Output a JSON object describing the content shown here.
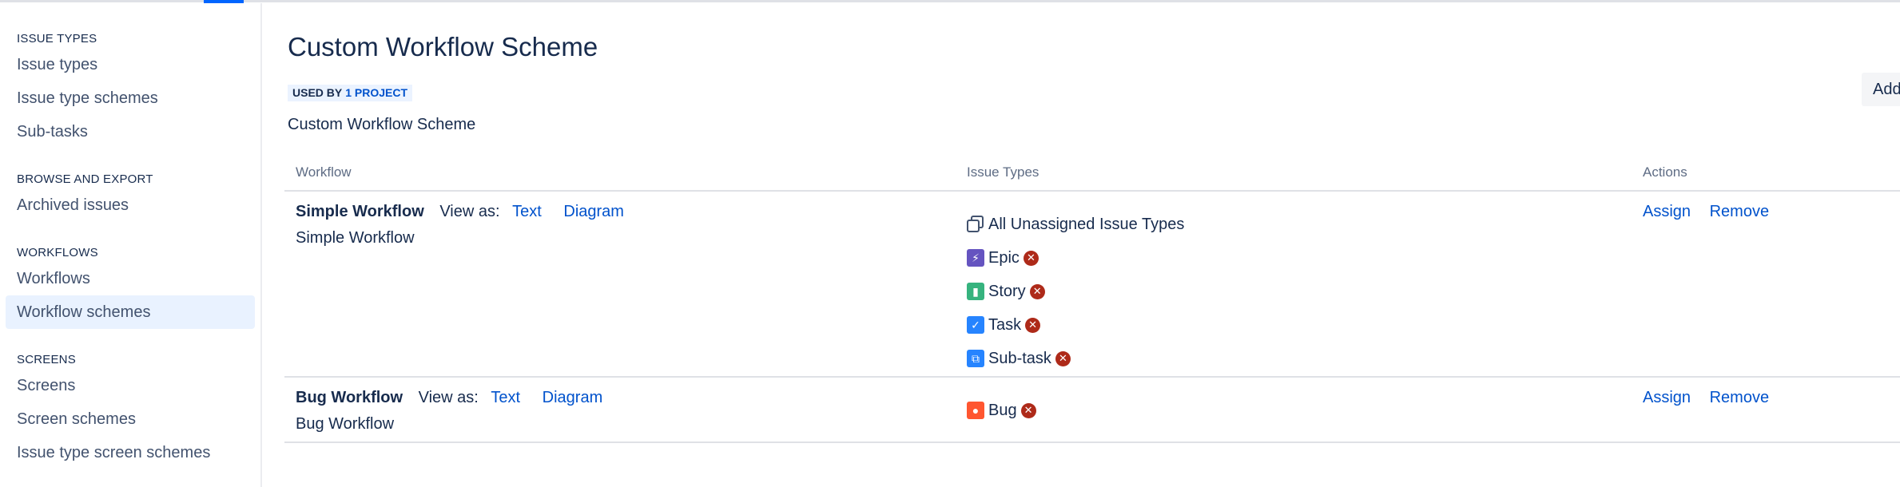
{
  "sidebar": {
    "sections": [
      {
        "heading": "ISSUE TYPES",
        "items": [
          "Issue types",
          "Issue type schemes",
          "Sub-tasks"
        ]
      },
      {
        "heading": "BROWSE AND EXPORT",
        "items": [
          "Archived issues"
        ]
      },
      {
        "heading": "WORKFLOWS",
        "items": [
          "Workflows",
          "Workflow schemes"
        ]
      },
      {
        "heading": "SCREENS",
        "items": [
          "Screens",
          "Screen schemes",
          "Issue type screen schemes"
        ]
      }
    ],
    "active_item": "Workflow schemes"
  },
  "main": {
    "title": "Custom Workflow Scheme",
    "used_by_label": "USED BY",
    "used_by_link": "1 PROJECT",
    "description": "Custom Workflow Scheme",
    "add_button": "Add",
    "columns": {
      "workflow": "Workflow",
      "issue_types": "Issue Types",
      "actions": "Actions"
    },
    "rows": [
      {
        "name": "Simple Workflow",
        "view_as": "View as:",
        "text_link": "Text",
        "diagram_link": "Diagram",
        "desc": "Simple Workflow",
        "types": [
          {
            "label": "All Unassigned Issue Types",
            "icon": "copy-icon",
            "removable": false
          },
          {
            "label": "Epic",
            "icon": "epic-icon",
            "color": "#6554c0",
            "removable": true
          },
          {
            "label": "Story",
            "icon": "story-icon",
            "color": "#36b37e",
            "removable": true
          },
          {
            "label": "Task",
            "icon": "task-icon",
            "color": "#2684ff",
            "removable": true
          },
          {
            "label": "Sub-task",
            "icon": "subtask-icon",
            "color": "#2684ff",
            "removable": true
          }
        ],
        "assign": "Assign",
        "remove": "Remove"
      },
      {
        "name": "Bug Workflow",
        "view_as": "View as:",
        "text_link": "Text",
        "diagram_link": "Diagram",
        "desc": "Bug Workflow",
        "types": [
          {
            "label": "Bug",
            "icon": "bug-icon",
            "color": "#ff5630",
            "removable": true
          }
        ],
        "assign": "Assign",
        "remove": "Remove"
      }
    ]
  },
  "colors": {
    "link": "#0052cc",
    "active_bg": "#e9f2ff",
    "remove_x": "#ae2a19"
  }
}
